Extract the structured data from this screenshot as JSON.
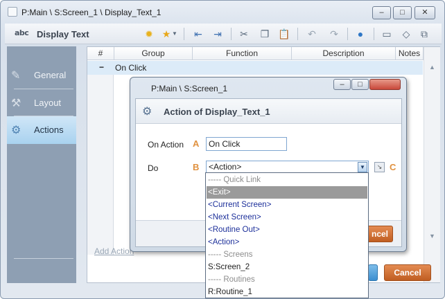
{
  "window": {
    "title": "P:Main \\ S:Screen_1 \\ Display_Text_1",
    "minimize": "–",
    "maximize": "□",
    "close": "✕"
  },
  "toolbar": {
    "logo": "abc",
    "title": "Display Text",
    "icons": [
      "bulb-icon",
      "star-icon",
      "indent-left-icon",
      "indent-right-icon",
      "cut-icon",
      "copy-icon",
      "paste-icon",
      "undo-icon",
      "redo-icon",
      "info-icon",
      "comment-icon",
      "tag-icon",
      "export-icon"
    ]
  },
  "sidenav": {
    "items": [
      {
        "label": "General",
        "icon": "pencil-icon"
      },
      {
        "label": "Layout",
        "icon": "wrench-icon"
      },
      {
        "label": "Actions",
        "icon": "gears-icon"
      }
    ]
  },
  "grid": {
    "columns": [
      "#",
      "Group",
      "Function",
      "Description",
      "Notes"
    ],
    "group_row": {
      "toggle": "−",
      "label": "On Click"
    },
    "add_action": "Add Action"
  },
  "dialog": {
    "title": "P:Main \\ S:Screen_1",
    "heading": "Action of Display_Text_1",
    "on_action_label": "On Action",
    "on_action_value": "On Click",
    "do_label": "Do",
    "do_value": "<Action>",
    "markers": {
      "a": "A",
      "b": "B",
      "c": "C"
    },
    "cancel_partial": "ncel"
  },
  "dropdown": {
    "options": [
      {
        "label": "----- Quick Link",
        "kind": "hdr"
      },
      {
        "label": "<Exit>",
        "kind": "sel"
      },
      {
        "label": "<Current Screen>",
        "kind": "link"
      },
      {
        "label": "<Next Screen>",
        "kind": "link"
      },
      {
        "label": "<Routine Out>",
        "kind": "link"
      },
      {
        "label": "<Action>",
        "kind": "link"
      },
      {
        "label": "----- Screens",
        "kind": "hdr"
      },
      {
        "label": "S:Screen_2",
        "kind": "plain"
      },
      {
        "label": "----- Routines",
        "kind": "hdr"
      },
      {
        "label": "R:Routine_1",
        "kind": "plain"
      }
    ]
  },
  "footer": {
    "cancel": "Cancel"
  }
}
